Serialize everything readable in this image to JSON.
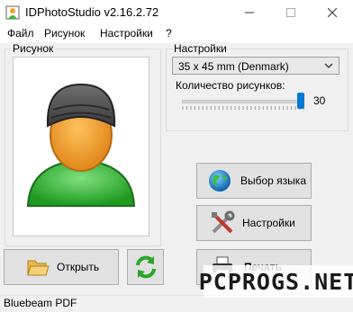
{
  "window": {
    "title": "IDPhotoStudio v2.16.2.72",
    "minimize_icon": "minimize-icon",
    "maximize_icon": "maximize-icon",
    "close_icon": "close-icon"
  },
  "menu": [
    "Файл",
    "Рисунок",
    "Настройки",
    "?"
  ],
  "picture_group": {
    "label": "Рисунок"
  },
  "settings_group": {
    "label": "Настройки",
    "format_value": "35 x 45 mm (Denmark)",
    "count_label": "Количество рисунков:",
    "count_value": "30",
    "count_fraction": 1.0
  },
  "buttons": {
    "language": "Выбор языка",
    "settings": "Настройки",
    "open": "Открыть",
    "print": "Печать"
  },
  "status": {
    "text": "Bluebeam PDF"
  },
  "watermark": {
    "text": "PCPROGS.NET"
  },
  "colors": {
    "accent": "#0078d7",
    "avatar_body": "#3cb93c",
    "avatar_face": "#f5a02a"
  }
}
